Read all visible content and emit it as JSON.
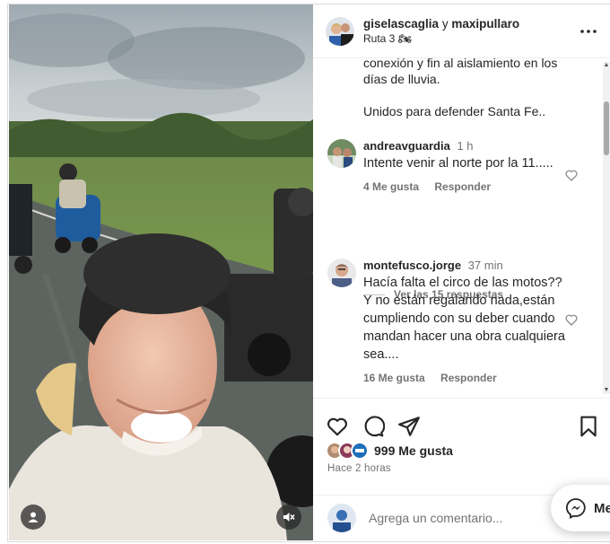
{
  "post": {
    "header": {
      "username1": "giselascaglia",
      "joiner": "y",
      "username2": "maxipullaro",
      "location": "Ruta 3 🏍"
    },
    "caption_tail": {
      "line1": "conexión y fin al aislamiento en los días de lluvia.",
      "line2": "Unidos para defender Santa Fe.."
    },
    "comments": [
      {
        "user": "andreavguardia",
        "time": "1 h",
        "text": "Intente venir al norte por la 11.....",
        "likes": "4 Me gusta",
        "reply": "Responder"
      },
      {
        "user": "montefusco.jorge",
        "time": "37 min",
        "text": "Hacía falta el circo de las motos??Y no están regalando nada,están cumpliendo con su deber cuando mandan hacer una obra cualquiera sea....",
        "likes": "16 Me gusta",
        "reply": "Responder"
      }
    ],
    "view_replies": "Ver las 15 respuestas",
    "likes_count": "999 Me gusta",
    "time_ago": "Hace 2 horas",
    "comment_placeholder": "Agrega un comentario...",
    "messages_label": "Me"
  },
  "colors": {
    "text_primary": "#262626",
    "text_secondary": "#737373",
    "border": "#efefef"
  },
  "icons": {
    "more": "more-options-icon",
    "like": "heart-icon",
    "comment": "comment-icon",
    "share": "share-icon",
    "save": "bookmark-icon",
    "mute": "mute-icon",
    "tagged": "tagged-user-icon",
    "messenger": "messenger-icon"
  }
}
